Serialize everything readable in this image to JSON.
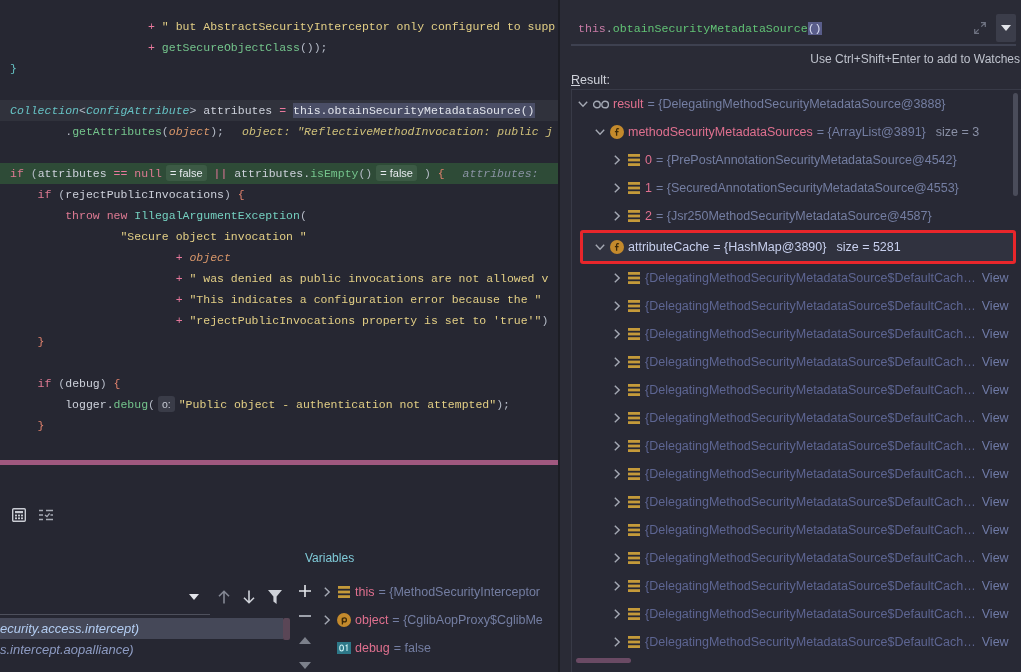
{
  "editor": {
    "lines": [
      {
        "kind": "code",
        "segments": [
          {
            "kind": "code",
            "tokens": [
              {
                "kind": "op",
                "text": "                    +"
              },
              {
                "kind": "string",
                "text": " \" but AbstractSecurityInterceptor only configured to supp"
              }
            ]
          }
        ]
      },
      {
        "kind": "code",
        "segments": [
          {
            "kind": "code",
            "tokens": [
              {
                "kind": "op",
                "text": "                    +"
              },
              {
                "kind": "method",
                "text": " getSecureObjectClass"
              },
              {
                "kind": "punct",
                "text": "());"
              }
            ]
          }
        ]
      },
      {
        "kind": "code",
        "segments": [
          {
            "kind": "code",
            "tokens": [
              {
                "kind": "brace_alt",
                "text": "}"
              }
            ]
          }
        ]
      },
      {
        "kind": "blank"
      },
      {
        "kind": "current",
        "segments": [
          {
            "kind": "code",
            "tokens": [
              {
                "kind": "type",
                "text": "Collection"
              },
              {
                "kind": "punct",
                "text": "<"
              },
              {
                "kind": "type",
                "text": "ConfigAttribute"
              },
              {
                "kind": "punct",
                "text": ">"
              },
              {
                "kind": "plain",
                "text": " attributes "
              },
              {
                "kind": "op",
                "text": "="
              }
            ]
          },
          {
            "kind": "selection",
            "tokens": [
              {
                "kind": "plain",
                "text": "this.obtainSecurityMetadataSource()"
              }
            ]
          }
        ]
      },
      {
        "kind": "code",
        "segments": [
          {
            "kind": "code",
            "tokens": [
              {
                "kind": "punct",
                "text": "        ."
              },
              {
                "kind": "method",
                "text": "getAttributes"
              },
              {
                "kind": "punct",
                "text": "("
              },
              {
                "kind": "param",
                "text": "object"
              },
              {
                "kind": "punct",
                "text": ");"
              }
            ]
          },
          {
            "kind": "value_hint",
            "text": "object: \"ReflectiveMethodInvocation: public j"
          }
        ]
      },
      {
        "kind": "blank"
      },
      {
        "kind": "execution",
        "segments": [
          {
            "kind": "code",
            "tokens": [
              {
                "kind": "kw",
                "text": "if"
              },
              {
                "kind": "punct",
                "text": " ("
              },
              {
                "kind": "plain",
                "text": "attributes "
              },
              {
                "kind": "op",
                "text": "=="
              },
              {
                "kind": "kw",
                "text": " null"
              }
            ]
          },
          {
            "kind": "inline_value",
            "text": "= false"
          },
          {
            "kind": "code",
            "tokens": [
              {
                "kind": "op",
                "text": " ||"
              },
              {
                "kind": "plain",
                "text": " attributes."
              },
              {
                "kind": "method",
                "text": "isEmpty"
              },
              {
                "kind": "punct",
                "text": "()"
              }
            ]
          },
          {
            "kind": "inline_value",
            "text": "= false"
          },
          {
            "kind": "code",
            "tokens": [
              {
                "kind": "punct",
                "text": " ) "
              },
              {
                "kind": "brace",
                "text": "{"
              }
            ]
          },
          {
            "kind": "value_hint",
            "text": "attributes:"
          }
        ]
      },
      {
        "kind": "code",
        "segments": [
          {
            "kind": "code",
            "tokens": [
              {
                "kind": "kw",
                "text": "    if"
              },
              {
                "kind": "punct",
                "text": " ("
              },
              {
                "kind": "plain",
                "text": "rejectPublicInvocations"
              },
              {
                "kind": "punct",
                "text": ") "
              },
              {
                "kind": "brace",
                "text": "{"
              }
            ]
          }
        ]
      },
      {
        "kind": "code",
        "segments": [
          {
            "kind": "code",
            "tokens": [
              {
                "kind": "kw",
                "text": "        throw new"
              },
              {
                "kind": "cls",
                "text": " IllegalArgumentException"
              },
              {
                "kind": "punct",
                "text": "("
              }
            ]
          }
        ]
      },
      {
        "kind": "code",
        "segments": [
          {
            "kind": "code",
            "tokens": [
              {
                "kind": "string",
                "text": "                \"Secure object invocation \""
              }
            ]
          }
        ]
      },
      {
        "kind": "code",
        "segments": [
          {
            "kind": "code",
            "tokens": [
              {
                "kind": "op",
                "text": "                        +"
              },
              {
                "kind": "param",
                "text": " object"
              }
            ]
          }
        ]
      },
      {
        "kind": "code",
        "segments": [
          {
            "kind": "code",
            "tokens": [
              {
                "kind": "op",
                "text": "                        +"
              },
              {
                "kind": "string",
                "text": " \" was denied as public invocations are not allowed v"
              }
            ]
          }
        ]
      },
      {
        "kind": "code",
        "segments": [
          {
            "kind": "code",
            "tokens": [
              {
                "kind": "op",
                "text": "                        +"
              },
              {
                "kind": "string",
                "text": " \"This indicates a configuration error because the \""
              }
            ]
          }
        ]
      },
      {
        "kind": "code",
        "segments": [
          {
            "kind": "code",
            "tokens": [
              {
                "kind": "op",
                "text": "                        +"
              },
              {
                "kind": "string",
                "text": " \"rejectPublicInvocations property is set to 'true'\""
              },
              {
                "kind": "punct",
                "text": ")"
              }
            ]
          }
        ]
      },
      {
        "kind": "code",
        "segments": [
          {
            "kind": "code",
            "tokens": [
              {
                "kind": "brace",
                "text": "    }"
              }
            ]
          }
        ]
      },
      {
        "kind": "blank"
      },
      {
        "kind": "code",
        "segments": [
          {
            "kind": "code",
            "tokens": [
              {
                "kind": "kw",
                "text": "    if"
              },
              {
                "kind": "punct",
                "text": " ("
              },
              {
                "kind": "plain",
                "text": "debug"
              },
              {
                "kind": "punct",
                "text": ") "
              },
              {
                "kind": "brace",
                "text": "{"
              }
            ]
          }
        ]
      },
      {
        "kind": "code",
        "segments": [
          {
            "kind": "code",
            "tokens": [
              {
                "kind": "plain",
                "text": "        logger."
              },
              {
                "kind": "method",
                "text": "debug"
              },
              {
                "kind": "punct",
                "text": "("
              }
            ]
          },
          {
            "kind": "param_hint",
            "text": "o:"
          },
          {
            "kind": "code",
            "tokens": [
              {
                "kind": "string",
                "text": "\"Public object - authentication not attempted\""
              },
              {
                "kind": "punct",
                "text": ");"
              }
            ]
          }
        ]
      },
      {
        "kind": "code",
        "segments": [
          {
            "kind": "code",
            "tokens": [
              {
                "kind": "brace",
                "text": "    }"
              }
            ]
          }
        ]
      }
    ]
  },
  "frames": {
    "items": [
      {
        "text": "ecurity.access.intercept)",
        "selected": true
      },
      {
        "text": "s.intercept.aopalliance)",
        "selected": false
      }
    ]
  },
  "variables": {
    "title": "Variables",
    "items": [
      {
        "kind": "object",
        "name": "this",
        "value": "= {MethodSecurityInterceptor",
        "expanded": false
      },
      {
        "kind": "parameter",
        "name": "object",
        "value": "= {CglibAopProxy$CglibMe",
        "expanded": false
      },
      {
        "kind": "primitive",
        "name": "debug",
        "value": "= false"
      }
    ]
  },
  "expression": {
    "tokens": [
      {
        "kind": "kw",
        "text": "this"
      },
      {
        "kind": "punct",
        "text": "."
      },
      {
        "kind": "method",
        "text": "obtainSecurityMetadataSource"
      },
      {
        "kind": "selected",
        "text": "()"
      }
    ]
  },
  "hint": "Use Ctrl+Shift+Enter to add to Watches",
  "result_label": "Result:",
  "result_tree": {
    "nodes": [
      {
        "kind": "watch",
        "name": "result",
        "value": "= {DelegatingMethodSecurityMetadataSource@3888}",
        "expanded": true,
        "selected": false,
        "highlighted": false,
        "children": [
          {
            "kind": "field",
            "name": "methodSecurityMetadataSources",
            "value": "= {ArrayList@3891}",
            "size": "size = 3",
            "expanded": true,
            "selected": false,
            "highlighted": false,
            "children": [
              {
                "kind": "element",
                "name": "0",
                "value": "= {PrePostAnnotationSecurityMetadataSource@4542}",
                "expanded": false,
                "selected": false,
                "highlighted": false
              },
              {
                "kind": "element",
                "name": "1",
                "value": "= {SecuredAnnotationSecurityMetadataSource@4553}",
                "expanded": false,
                "selected": false,
                "highlighted": false
              },
              {
                "kind": "element",
                "name": "2",
                "value": "= {Jsr250MethodSecurityMetadataSource@4587}",
                "expanded": false,
                "selected": false,
                "highlighted": false
              }
            ]
          },
          {
            "kind": "field",
            "name": "attributeCache",
            "value": "= {HashMap@3890}",
            "size": "size = 5281",
            "expanded": true,
            "selected": true,
            "highlighted": true,
            "children": [
              {
                "kind": "element",
                "value": "{DelegatingMethodSecurityMetadataSource$DefaultCach…",
                "link": "View",
                "expanded": false,
                "selected": false,
                "highlighted": false
              },
              {
                "kind": "element",
                "value": "{DelegatingMethodSecurityMetadataSource$DefaultCach…",
                "link": "View",
                "expanded": false,
                "selected": false,
                "highlighted": false
              },
              {
                "kind": "element",
                "value": "{DelegatingMethodSecurityMetadataSource$DefaultCach…",
                "link": "View",
                "expanded": false,
                "selected": false,
                "highlighted": false
              },
              {
                "kind": "element",
                "value": "{DelegatingMethodSecurityMetadataSource$DefaultCach…",
                "link": "View",
                "expanded": false,
                "selected": false,
                "highlighted": false
              },
              {
                "kind": "element",
                "value": "{DelegatingMethodSecurityMetadataSource$DefaultCach…",
                "link": "View",
                "expanded": false,
                "selected": false,
                "highlighted": false
              },
              {
                "kind": "element",
                "value": "{DelegatingMethodSecurityMetadataSource$DefaultCach…",
                "link": "View",
                "expanded": false,
                "selected": false,
                "highlighted": false
              },
              {
                "kind": "element",
                "value": "{DelegatingMethodSecurityMetadataSource$DefaultCach…",
                "link": "View",
                "expanded": false,
                "selected": false,
                "highlighted": false
              },
              {
                "kind": "element",
                "value": "{DelegatingMethodSecurityMetadataSource$DefaultCach…",
                "link": "View",
                "expanded": false,
                "selected": false,
                "highlighted": false
              },
              {
                "kind": "element",
                "value": "{DelegatingMethodSecurityMetadataSource$DefaultCach…",
                "link": "View",
                "expanded": false,
                "selected": false,
                "highlighted": false
              },
              {
                "kind": "element",
                "value": "{DelegatingMethodSecurityMetadataSource$DefaultCach…",
                "link": "View",
                "expanded": false,
                "selected": false,
                "highlighted": false
              },
              {
                "kind": "element",
                "value": "{DelegatingMethodSecurityMetadataSource$DefaultCach…",
                "link": "View",
                "expanded": false,
                "selected": false,
                "highlighted": false
              },
              {
                "kind": "element",
                "value": "{DelegatingMethodSecurityMetadataSource$DefaultCach…",
                "link": "View",
                "expanded": false,
                "selected": false,
                "highlighted": false
              },
              {
                "kind": "element",
                "value": "{DelegatingMethodSecurityMetadataSource$DefaultCach…",
                "link": "View",
                "expanded": false,
                "selected": false,
                "highlighted": false
              },
              {
                "kind": "element",
                "value": "{DelegatingMethodSecurityMetadataSource$DefaultCach…",
                "link": "View",
                "expanded": false,
                "selected": false,
                "highlighted": false
              }
            ]
          }
        ]
      }
    ]
  }
}
